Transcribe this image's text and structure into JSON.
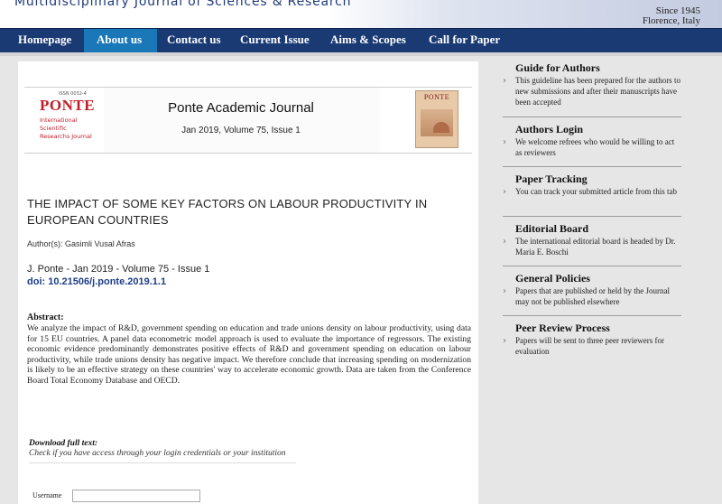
{
  "header": {
    "title": "Multidisciplinary Journal of Sciences & Research",
    "since": "Since 1945",
    "location": "Florence, Italy"
  },
  "nav": {
    "items": [
      {
        "label": "Homepage"
      },
      {
        "label": "About us"
      },
      {
        "label": "Contact us"
      },
      {
        "label": "Current Issue"
      },
      {
        "label": "Aims & Scopes"
      },
      {
        "label": "Call for Paper"
      }
    ],
    "active": "About us"
  },
  "journal_box": {
    "logo_sup": "ISSN 0032-4",
    "logo_text": "PONTE",
    "logo_sub": "International Scientific Researchs Journal",
    "name": "Ponte Academic Journal",
    "issue": "Jan 2019, Volume 75, Issue 1",
    "cover_title": "PONTE"
  },
  "article": {
    "title": "THE IMPACT OF SOME KEY FACTORS ON LABOUR PRODUCTIVITY IN EUROPEAN COUNTRIES",
    "authors": "Author(s): Gasimli Vusal Afras",
    "citation": "J. Ponte - Jan 2019 - Volume 75 - Issue 1",
    "doi": "doi: 10.21506/j.ponte.2019.1.1",
    "abstract_label": "Abstract:",
    "abstract": "We analyze the impact of R&D, government spending on education and trade unions density on labour productivity, using data for 15 EU countries. A panel data econometric model approach is used to evaluate the importance of regressors. The existing economic evidence predominantly demonstrates positive effects of R&D and government spending on education on labour productivity, while trade unions density has negative impact. We therefore conclude that increasing spending on modernization is likely to be an effective strategy on these countries' way to accelerate economic growth. Data are taken from the Conference Board Total Economy Database and OECD."
  },
  "download": {
    "title": "Download full text:",
    "note": "Check if you have access through your login credentials or your institution",
    "username_label": "Username",
    "username_value": ""
  },
  "sidebar": [
    {
      "heading": "Guide for Authors",
      "desc": "This guideline has been prepared for the authors to new submissions and after their manuscripts have been accepted"
    },
    {
      "heading": "Authors Login",
      "desc": "We welcome refrees who would be willing to act as reviewers"
    },
    {
      "heading": "Paper Tracking",
      "desc": "You can track your submitted article from this tab"
    },
    {
      "heading": "Editorial Board",
      "desc": "The international editorial board is headed by Dr. Maria E. Boschi"
    },
    {
      "heading": "General Policies",
      "desc": "Papers that are published or held by the Journal may not be published elsewhere"
    },
    {
      "heading": "Peer Review Process",
      "desc": "Papers will be sent to three peer reviewers for evaluation"
    }
  ],
  "colors": {
    "nav_bg": "#1a3a74",
    "nav_active": "#1a77b8",
    "doi_link": "#1d3e8a",
    "logo_red": "#c0202a"
  }
}
